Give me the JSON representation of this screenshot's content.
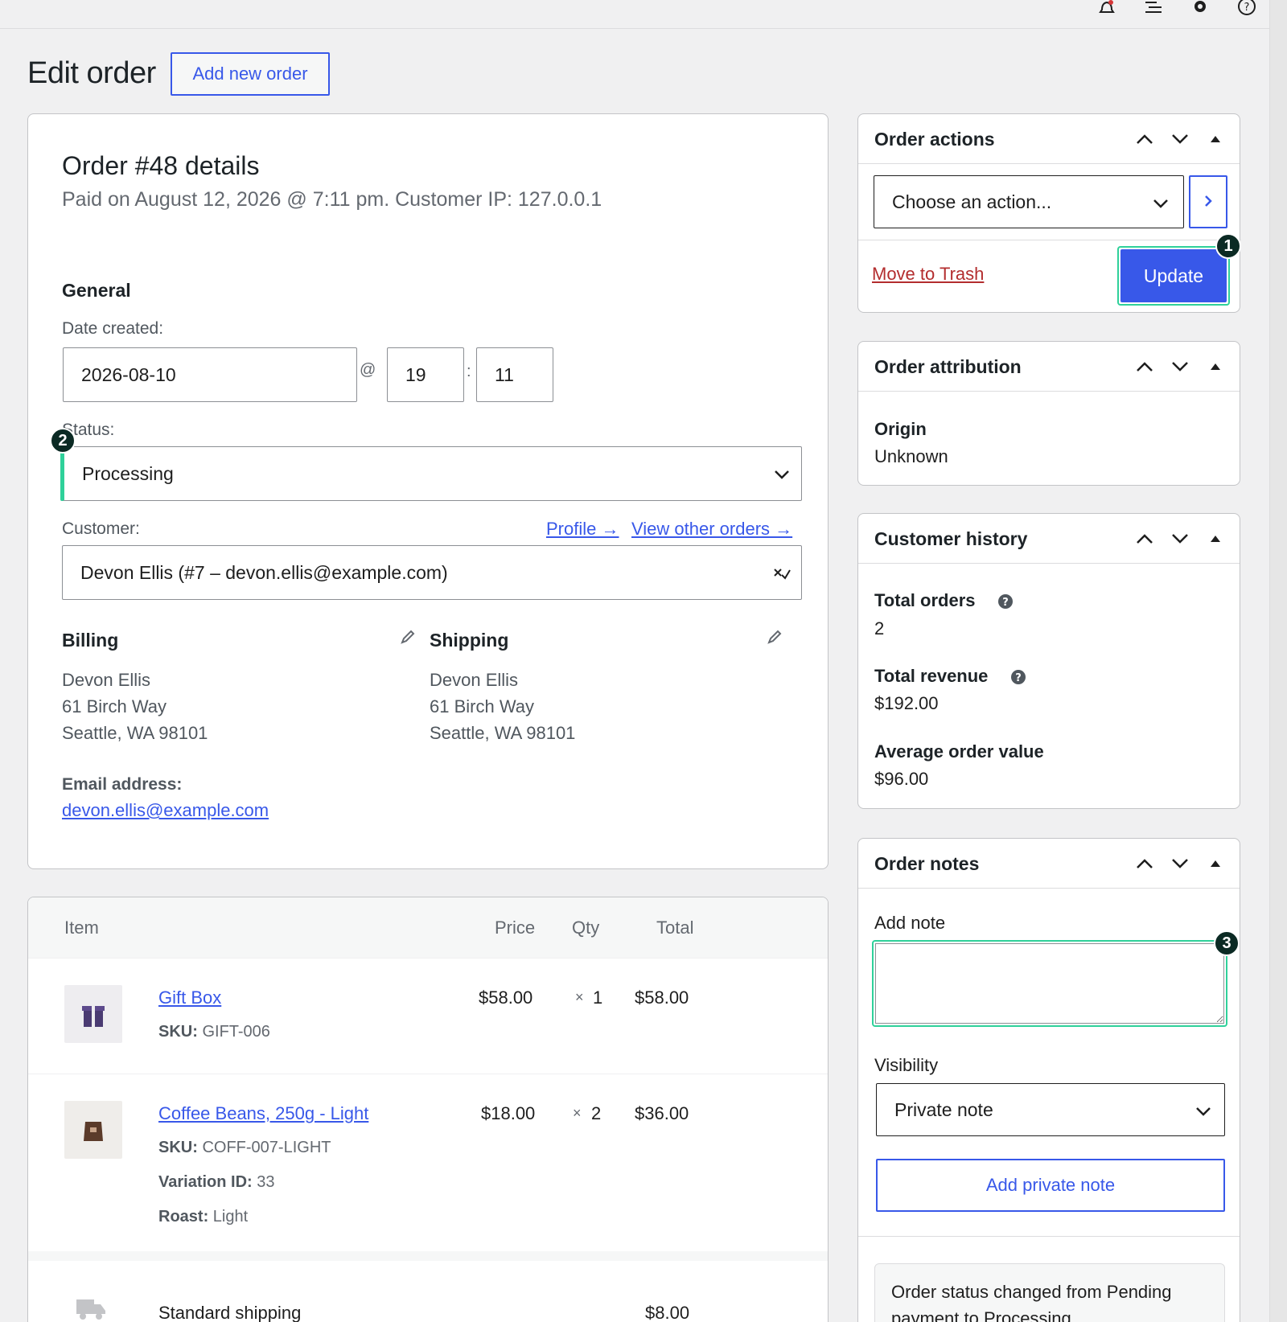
{
  "page": {
    "title": "Edit order",
    "add_new_label": "Add new order"
  },
  "order": {
    "heading": "Order #48 details",
    "paid_line": "Paid on August 12, 2026 @ 7:11 pm. Customer IP: 127.0.0.1",
    "general_heading": "General",
    "date_label": "Date created:",
    "date_value": "2026-08-10",
    "at_sep": "@",
    "hour_value": "19",
    "colon_sep": ":",
    "minute_value": "11",
    "status_label": "Status:",
    "status_value": "Processing",
    "customer_label": "Customer:",
    "profile_link": "Profile →",
    "other_orders_link": "View other orders →",
    "customer_value": "Devon Ellis (#7 – devon.ellis@example.com)",
    "billing": {
      "heading": "Billing",
      "name": "Devon Ellis",
      "street": "61 Birch Way",
      "city": "Seattle, WA 98101",
      "email_label": "Email address:",
      "email": "devon.ellis@example.com"
    },
    "shipping": {
      "heading": "Shipping",
      "name": "Devon Ellis",
      "street": "61 Birch Way",
      "city": "Seattle, WA 98101"
    }
  },
  "items": {
    "headers": {
      "item": "Item",
      "price": "Price",
      "qty": "Qty",
      "total": "Total"
    },
    "rows": [
      {
        "name": "Gift Box",
        "sku_label": "SKU:",
        "sku": "GIFT-006",
        "price": "$58.00",
        "qty_x": "×",
        "qty": "1",
        "total": "$58.00"
      },
      {
        "name": "Coffee Beans, 250g - Light",
        "sku_label": "SKU:",
        "sku": "COFF-007-LIGHT",
        "variation_label": "Variation ID:",
        "variation": "33",
        "roast_label": "Roast:",
        "roast": "Light",
        "price": "$18.00",
        "qty_x": "×",
        "qty": "2",
        "total": "$36.00"
      }
    ],
    "shipping_line": {
      "name": "Standard shipping",
      "total": "$8.00"
    }
  },
  "actions": {
    "title": "Order actions",
    "select_value": "Choose an action...",
    "trash_label": "Move to Trash",
    "update_label": "Update"
  },
  "attribution": {
    "title": "Order attribution",
    "origin_label": "Origin",
    "origin_value": "Unknown"
  },
  "history": {
    "title": "Customer history",
    "total_orders_label": "Total orders",
    "total_orders_value": "2",
    "total_revenue_label": "Total revenue",
    "total_revenue_value": "$192.00",
    "avg_label": "Average order value",
    "avg_value": "$96.00"
  },
  "notes": {
    "title": "Order notes",
    "add_note_label": "Add note",
    "note_value": "",
    "visibility_label": "Visibility",
    "visibility_value": "Private note",
    "add_button": "Add private note",
    "note_text": "Order status changed from Pending payment to Processing."
  },
  "badges": {
    "one": "1",
    "two": "2",
    "three": "3"
  },
  "colors": {
    "accent": "#3858e9",
    "focus": "#2fd19a",
    "trash": "#b32d2e",
    "badge": "#0b2a24"
  },
  "icons": {
    "topbar": [
      "bell-icon",
      "list-icon",
      "gear-icon",
      "help-icon"
    ],
    "edit": "pencil-icon",
    "dropdown": "chevron-down-icon",
    "go": "chevron-right-icon",
    "help": "question-circle-icon"
  }
}
